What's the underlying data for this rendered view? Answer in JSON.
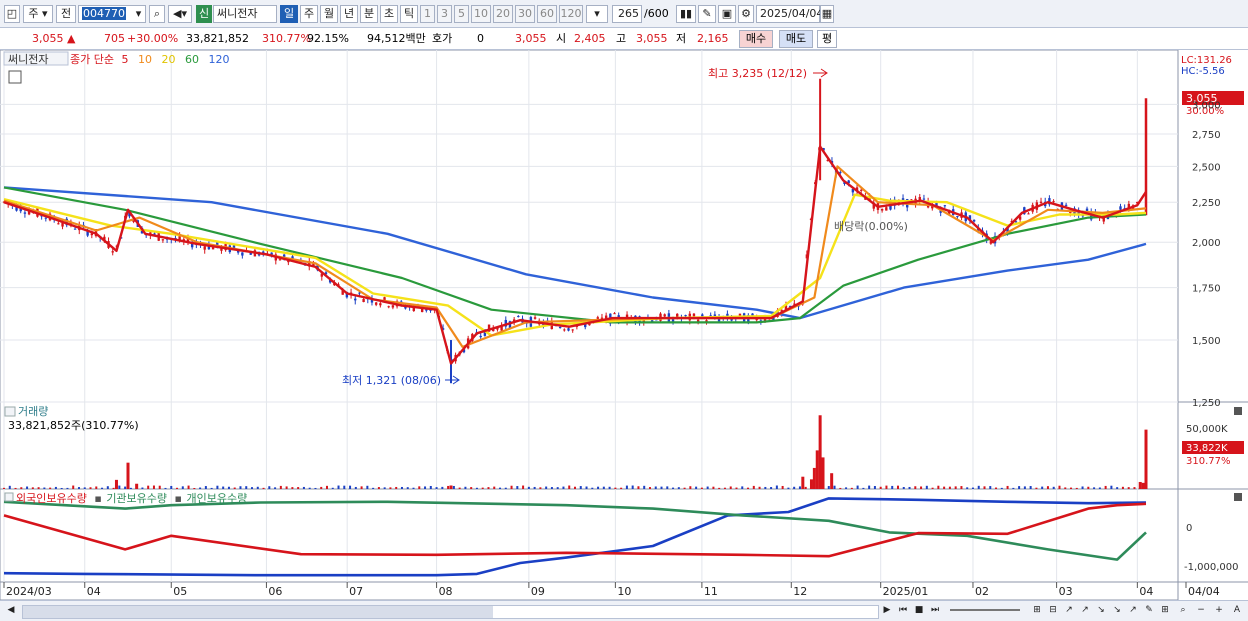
{
  "toolbar": {
    "tab_weekly": "주",
    "tab_prev": "전",
    "code": "004770",
    "new_badge": "신",
    "stock_name": "써니전자",
    "periods": [
      "일",
      "주",
      "월",
      "년",
      "분",
      "초",
      "틱"
    ],
    "active_period": "일",
    "intervals": [
      "1",
      "3",
      "5",
      "10",
      "20",
      "30",
      "60",
      "120"
    ],
    "count": "265",
    "count_max": "/600",
    "date": "2025/04/04"
  },
  "quote": {
    "price": "3,055",
    "change": "705",
    "change_pct": "+30.00%",
    "volume": "33,821,852",
    "volume_ratio": "310.77%",
    "turnover": "92.15%",
    "amount": "94,512백만",
    "hoga_label": "호가",
    "hoga_value": "0",
    "hoga_price": "3,055",
    "open_label": "시",
    "open": "2,405",
    "high_label": "고",
    "high": "3,055",
    "low_label": "저",
    "low": "2,165",
    "buy_label": "매수",
    "sell_label": "매도",
    "avg_label": "평"
  },
  "indicators": {
    "stock_tag": "써니전자",
    "ma_title": "종가 단순",
    "ma_periods": [
      "5",
      "10",
      "20",
      "60",
      "120"
    ],
    "lc": "LC:131.26",
    "hc": "HC:-5.56",
    "high_annotation": "최고 3,235 (12/12)",
    "low_annotation": "최저 1,321 (08/06)",
    "mid_annotation": "배당락(0.00%)",
    "price_tag": "3,055",
    "price_tag_pct": "30.00%",
    "volume_title": "거래량",
    "volume_value": "33,821,852주(310.77%)",
    "volume_tag": "33,822K",
    "volume_tag_pct": "310.77%",
    "holding_legend": [
      "외국인보유수량",
      "기관보유수량",
      "개인보유수량"
    ]
  },
  "colors": {
    "up": "#d6141b",
    "down": "#1a3fc4",
    "ma5": "#d6141b",
    "ma10": "#f08a1c",
    "ma20": "#f5e21a",
    "ma60": "#2a9a3c",
    "ma120": "#2f62d8",
    "foreign": "#1a3fc4",
    "institution": "#2e8b5a",
    "individual": "#d6141b"
  },
  "chart_data": [
    {
      "type": "line",
      "title": "",
      "series": [
        {
          "name": "5",
          "values": [
            [
              "2024-03-04",
              2250
            ],
            [
              "2024-03-20",
              2150
            ],
            [
              "2024-04-05",
              2050
            ],
            [
              "2024-04-12",
              1950
            ],
            [
              "2024-04-16",
              2200
            ],
            [
              "2024-04-22",
              2050
            ],
            [
              "2024-05-10",
              1990
            ],
            [
              "2024-06-03",
              1930
            ],
            [
              "2024-06-20",
              1860
            ],
            [
              "2024-07-01",
              1720
            ],
            [
              "2024-07-20",
              1660
            ],
            [
              "2024-08-01",
              1640
            ],
            [
              "2024-08-06",
              1400
            ],
            [
              "2024-08-15",
              1530
            ],
            [
              "2024-08-30",
              1590
            ],
            [
              "2024-09-16",
              1560
            ],
            [
              "2024-10-01",
              1600
            ],
            [
              "2024-10-20",
              1600
            ],
            [
              "2024-11-10",
              1600
            ],
            [
              "2024-11-25",
              1600
            ],
            [
              "2024-12-06",
              1680
            ],
            [
              "2024-12-12",
              2650
            ],
            [
              "2024-12-20",
              2400
            ],
            [
              "2025-01-01",
              2220
            ],
            [
              "2025-01-16",
              2260
            ],
            [
              "2025-02-01",
              2150
            ],
            [
              "2025-02-10",
              2000
            ],
            [
              "2025-02-20",
              2180
            ],
            [
              "2025-03-01",
              2250
            ],
            [
              "2025-03-10",
              2200
            ],
            [
              "2025-03-20",
              2150
            ],
            [
              "2025-04-01",
              2230
            ],
            [
              "2025-04-04",
              2320
            ]
          ]
        },
        {
          "name": "10",
          "values": [
            [
              "2024-03-04",
              2260
            ],
            [
              "2024-04-05",
              2070
            ],
            [
              "2024-04-20",
              2150
            ],
            [
              "2024-05-10",
              2000
            ],
            [
              "2024-06-20",
              1880
            ],
            [
              "2024-07-10",
              1690
            ],
            [
              "2024-08-01",
              1650
            ],
            [
              "2024-08-10",
              1470
            ],
            [
              "2024-09-01",
              1580
            ],
            [
              "2024-10-15",
              1600
            ],
            [
              "2024-11-25",
              1600
            ],
            [
              "2024-12-10",
              1700
            ],
            [
              "2024-12-18",
              2500
            ],
            [
              "2025-01-01",
              2250
            ],
            [
              "2025-01-20",
              2230
            ],
            [
              "2025-02-10",
              2010
            ],
            [
              "2025-03-01",
              2200
            ],
            [
              "2025-03-20",
              2180
            ],
            [
              "2025-04-04",
              2210
            ]
          ]
        },
        {
          "name": "20",
          "values": [
            [
              "2024-03-04",
              2270
            ],
            [
              "2024-04-10",
              2100
            ],
            [
              "2024-05-01",
              2050
            ],
            [
              "2024-06-20",
              1910
            ],
            [
              "2024-07-10",
              1720
            ],
            [
              "2024-08-05",
              1660
            ],
            [
              "2024-08-20",
              1520
            ],
            [
              "2024-09-10",
              1570
            ],
            [
              "2024-10-20",
              1600
            ],
            [
              "2024-11-25",
              1610
            ],
            [
              "2024-12-12",
              1800
            ],
            [
              "2024-12-24",
              2300
            ],
            [
              "2025-01-05",
              2260
            ],
            [
              "2025-01-25",
              2250
            ],
            [
              "2025-02-15",
              2100
            ],
            [
              "2025-03-05",
              2170
            ],
            [
              "2025-03-25",
              2170
            ],
            [
              "2025-04-04",
              2180
            ]
          ]
        },
        {
          "name": "60",
          "values": [
            [
              "2024-03-04",
              2350
            ],
            [
              "2024-04-15",
              2200
            ],
            [
              "2024-06-01",
              1990
            ],
            [
              "2024-07-20",
              1800
            ],
            [
              "2024-08-20",
              1640
            ],
            [
              "2024-10-01",
              1580
            ],
            [
              "2024-11-20",
              1580
            ],
            [
              "2024-12-05",
              1600
            ],
            [
              "2024-12-20",
              1760
            ],
            [
              "2025-01-15",
              1900
            ],
            [
              "2025-02-15",
              2050
            ],
            [
              "2025-03-15",
              2150
            ],
            [
              "2025-04-04",
              2170
            ]
          ]
        },
        {
          "name": "120",
          "values": [
            [
              "2024-03-04",
              2350
            ],
            [
              "2024-05-15",
              2250
            ],
            [
              "2024-07-15",
              2050
            ],
            [
              "2024-09-01",
              1820
            ],
            [
              "2024-10-15",
              1700
            ],
            [
              "2024-11-20",
              1640
            ],
            [
              "2024-12-05",
              1600
            ],
            [
              "2025-01-10",
              1750
            ],
            [
              "2025-02-15",
              1840
            ],
            [
              "2025-03-15",
              1900
            ],
            [
              "2025-04-04",
              1990
            ]
          ]
        }
      ],
      "candles_summary": {
        "last_close": 3055,
        "last_open": 2405,
        "last_high": 3055,
        "last_low": 2165
      },
      "annotations": [
        {
          "label": "최고 3,235 (12/12)",
          "x": "2024-12-12",
          "y": 3235
        },
        {
          "label": "최저 1,321 (08/06)",
          "x": "2024-08-06",
          "y": 1321
        }
      ],
      "ylim": [
        1250,
        3300
      ],
      "yticks": [
        "1,250",
        "1,500",
        "1,750",
        "2,000",
        "2,250",
        "2,500",
        "2,750",
        "3,000"
      ],
      "y_scale": "log",
      "grid": true,
      "legend_position": "top-left"
    },
    {
      "type": "bar",
      "title": "거래량",
      "unit": "주",
      "values": [
        [
          "2024-04-12",
          5200000
        ],
        [
          "2024-04-16",
          15000000
        ],
        [
          "2024-04-19",
          3000000
        ],
        [
          "2024-08-06",
          2000000
        ],
        [
          "2024-12-06",
          7000000
        ],
        [
          "2024-12-09",
          5500000
        ],
        [
          "2024-12-10",
          12000000
        ],
        [
          "2024-12-11",
          22000000
        ],
        [
          "2024-12-12",
          42000000
        ],
        [
          "2024-12-13",
          18000000
        ],
        [
          "2024-12-16",
          9000000
        ],
        [
          "2025-04-02",
          4000000
        ],
        [
          "2025-04-03",
          3500000
        ],
        [
          "2025-04-04",
          33821852
        ]
      ],
      "yticks": [
        "50,000K"
      ]
    },
    {
      "type": "line",
      "title": "",
      "series": [
        {
          "name": "외국인보유수량",
          "values": [
            [
              "2024-03-04",
              -1050000
            ],
            [
              "2024-04-01",
              -1060000
            ],
            [
              "2024-06-01",
              -1080000
            ],
            [
              "2024-08-01",
              -1080000
            ],
            [
              "2024-08-15",
              -1060000
            ],
            [
              "2024-08-30",
              -900000
            ],
            [
              "2024-09-15",
              -820000
            ],
            [
              "2024-10-15",
              -650000
            ],
            [
              "2024-11-10",
              -200000
            ],
            [
              "2024-12-01",
              -150000
            ],
            [
              "2024-12-15",
              50000
            ],
            [
              "2025-01-15",
              30000
            ],
            [
              "2025-02-15",
              0
            ],
            [
              "2025-03-15",
              -20000
            ],
            [
              "2025-04-04",
              -10000
            ]
          ]
        },
        {
          "name": "기관보유수량",
          "values": [
            [
              "2024-03-04",
              0
            ],
            [
              "2024-04-15",
              -100000
            ],
            [
              "2024-05-01",
              -50000
            ],
            [
              "2024-06-01",
              -10000
            ],
            [
              "2024-07-15",
              0
            ],
            [
              "2024-09-15",
              -50000
            ],
            [
              "2024-10-15",
              -100000
            ],
            [
              "2024-11-15",
              -200000
            ],
            [
              "2024-12-15",
              -280000
            ],
            [
              "2025-01-05",
              -450000
            ],
            [
              "2025-02-01",
              -500000
            ],
            [
              "2025-03-01",
              -700000
            ],
            [
              "2025-03-25",
              -850000
            ],
            [
              "2025-04-04",
              -450000
            ]
          ]
        },
        {
          "name": "개인보유수량",
          "values": [
            [
              "2024-03-04",
              -200000
            ],
            [
              "2024-04-15",
              -700000
            ],
            [
              "2024-05-01",
              -500000
            ],
            [
              "2024-06-15",
              -770000
            ],
            [
              "2024-08-01",
              -780000
            ],
            [
              "2024-09-15",
              -750000
            ],
            [
              "2024-11-15",
              -780000
            ],
            [
              "2024-12-15",
              -800000
            ],
            [
              "2025-01-15",
              -460000
            ],
            [
              "2025-02-15",
              -470000
            ],
            [
              "2025-03-15",
              -100000
            ],
            [
              "2025-03-25",
              -50000
            ],
            [
              "2025-04-04",
              -30000
            ]
          ]
        }
      ],
      "yticks": [
        "0",
        "-1,000,000"
      ]
    }
  ],
  "x_axis": {
    "labels": [
      "2024/03",
      "04",
      "05",
      "06",
      "07",
      "08",
      "09",
      "10",
      "11",
      "12",
      "2025/01",
      "02",
      "03",
      "04",
      "04/04"
    ]
  }
}
